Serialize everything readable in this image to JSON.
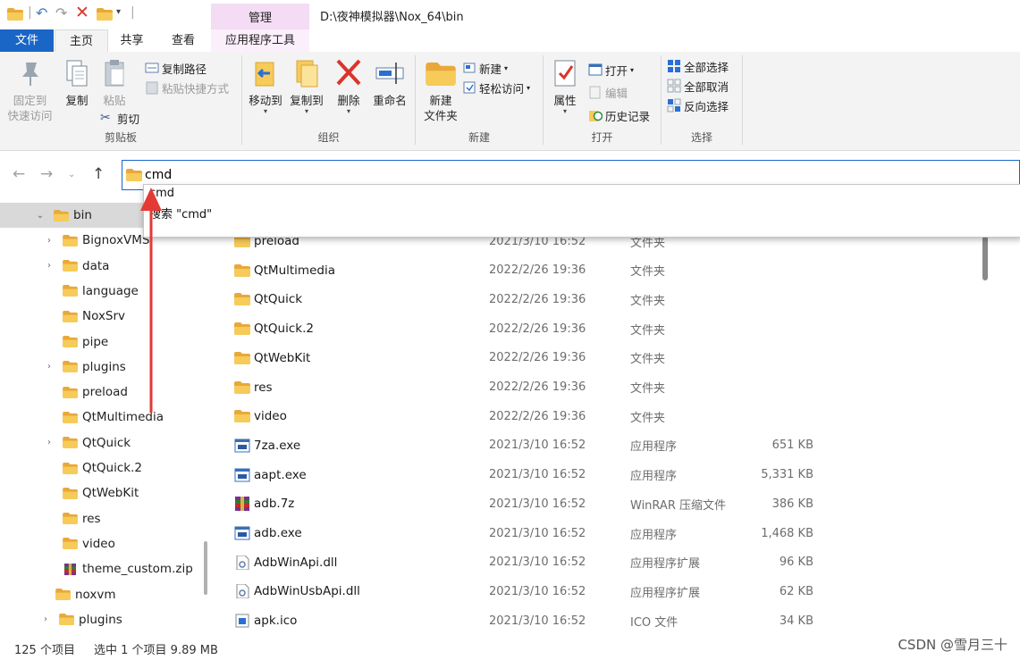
{
  "window": {
    "path_title": "D:\\夜神模拟器\\Nox_64\\bin",
    "context_tab_header": "管理"
  },
  "tabs": [
    "文件",
    "主页",
    "共享",
    "查看",
    "应用程序工具"
  ],
  "ribbon": {
    "clipboard": {
      "pin_line1": "固定到",
      "pin_line2": "快速访问",
      "copy": "复制",
      "paste": "粘贴",
      "copy_path": "复制路径",
      "paste_shortcut": "粘贴快捷方式",
      "cut": "剪切",
      "label": "剪贴板"
    },
    "organize": {
      "move_to": "移动到",
      "copy_to": "复制到",
      "delete": "删除",
      "rename": "重命名",
      "label": "组织"
    },
    "new": {
      "new_folder_line1": "新建",
      "new_folder_line2": "文件夹",
      "new_item": "新建",
      "easy_access": "轻松访问",
      "label": "新建"
    },
    "open": {
      "properties": "属性",
      "open": "打开",
      "edit": "编辑",
      "history": "历史记录",
      "label": "打开"
    },
    "select": {
      "select_all": "全部选择",
      "select_none": "全部取消",
      "invert": "反向选择",
      "label": "选择"
    }
  },
  "address": {
    "value": "cmd",
    "suggestions": [
      "cmd",
      "搜索 \"cmd\""
    ]
  },
  "tree": [
    {
      "label": "bin",
      "chev": "⌄",
      "indent": 0,
      "kind": "folder",
      "selected": true
    },
    {
      "label": "BignoxVMS",
      "chev": "›",
      "indent": 1,
      "kind": "folder"
    },
    {
      "label": "data",
      "chev": "›",
      "indent": 1,
      "kind": "folder"
    },
    {
      "label": "language",
      "chev": "",
      "indent": 1,
      "kind": "folder"
    },
    {
      "label": "NoxSrv",
      "chev": "",
      "indent": 1,
      "kind": "folder"
    },
    {
      "label": "pipe",
      "chev": "",
      "indent": 1,
      "kind": "folder"
    },
    {
      "label": "plugins",
      "chev": "›",
      "indent": 1,
      "kind": "folder"
    },
    {
      "label": "preload",
      "chev": "",
      "indent": 1,
      "kind": "folder"
    },
    {
      "label": "QtMultimedia",
      "chev": "",
      "indent": 1,
      "kind": "folder"
    },
    {
      "label": "QtQuick",
      "chev": "›",
      "indent": 1,
      "kind": "folder"
    },
    {
      "label": "QtQuick.2",
      "chev": "",
      "indent": 1,
      "kind": "folder"
    },
    {
      "label": "QtWebKit",
      "chev": "",
      "indent": 1,
      "kind": "folder"
    },
    {
      "label": "res",
      "chev": "",
      "indent": 1,
      "kind": "folder"
    },
    {
      "label": "video",
      "chev": "",
      "indent": 1,
      "kind": "folder"
    },
    {
      "label": "theme_custom.zip",
      "chev": "",
      "indent": 1,
      "kind": "rar"
    },
    {
      "label": "noxvm",
      "chev": "",
      "indent": 2,
      "kind": "folder"
    },
    {
      "label": "plugins",
      "chev": "›",
      "indent": 3,
      "kind": "folder"
    }
  ],
  "files": [
    {
      "name": "preload",
      "date": "2021/3/10 16:52",
      "type": "文件夹",
      "size": "",
      "kind": "folder"
    },
    {
      "name": "QtMultimedia",
      "date": "2022/2/26 19:36",
      "type": "文件夹",
      "size": "",
      "kind": "folder"
    },
    {
      "name": "QtQuick",
      "date": "2022/2/26 19:36",
      "type": "文件夹",
      "size": "",
      "kind": "folder"
    },
    {
      "name": "QtQuick.2",
      "date": "2022/2/26 19:36",
      "type": "文件夹",
      "size": "",
      "kind": "folder"
    },
    {
      "name": "QtWebKit",
      "date": "2022/2/26 19:36",
      "type": "文件夹",
      "size": "",
      "kind": "folder"
    },
    {
      "name": "res",
      "date": "2022/2/26 19:36",
      "type": "文件夹",
      "size": "",
      "kind": "folder"
    },
    {
      "name": "video",
      "date": "2022/2/26 19:36",
      "type": "文件夹",
      "size": "",
      "kind": "folder"
    },
    {
      "name": "7za.exe",
      "date": "2021/3/10 16:52",
      "type": "应用程序",
      "size": "651 KB",
      "kind": "exe"
    },
    {
      "name": "aapt.exe",
      "date": "2021/3/10 16:52",
      "type": "应用程序",
      "size": "5,331 KB",
      "kind": "exe"
    },
    {
      "name": "adb.7z",
      "date": "2021/3/10 16:52",
      "type": "WinRAR 压缩文件",
      "size": "386 KB",
      "kind": "rar"
    },
    {
      "name": "adb.exe",
      "date": "2021/3/10 16:52",
      "type": "应用程序",
      "size": "1,468 KB",
      "kind": "exe"
    },
    {
      "name": "AdbWinApi.dll",
      "date": "2021/3/10 16:52",
      "type": "应用程序扩展",
      "size": "96 KB",
      "kind": "dll"
    },
    {
      "name": "AdbWinUsbApi.dll",
      "date": "2021/3/10 16:52",
      "type": "应用程序扩展",
      "size": "62 KB",
      "kind": "dll"
    },
    {
      "name": "apk.ico",
      "date": "2021/3/10 16:52",
      "type": "ICO 文件",
      "size": "34 KB",
      "kind": "ico"
    }
  ],
  "status": {
    "count": "125 个项目",
    "selection": "选中 1 个项目  9.89 MB"
  },
  "watermark": "CSDN @雪月三十",
  "colors": {
    "accent": "#1a66c7",
    "folder": "#f2c14e",
    "context_tab": "#f4dcf4",
    "annotation_arrow": "#e53935"
  }
}
